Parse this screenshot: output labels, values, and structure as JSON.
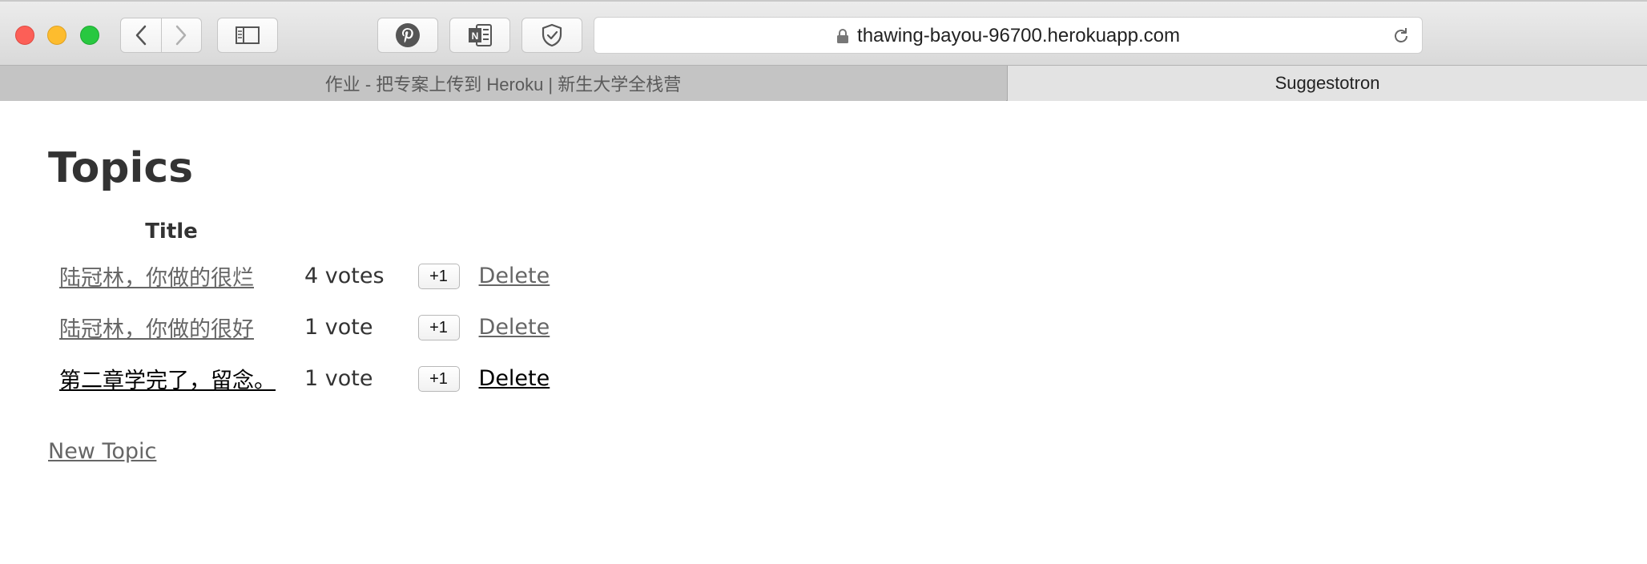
{
  "browser": {
    "url": "thawing-bayou-96700.herokuapp.com",
    "tabs": [
      {
        "label": "作业 - 把专案上传到 Heroku | 新生大学全栈营",
        "active": false
      },
      {
        "label": "Suggestotron",
        "active": true
      }
    ],
    "icons": [
      "back-icon",
      "forward-icon",
      "sidebar-icon",
      "pinterest-icon",
      "onenote-icon",
      "shield-icon",
      "lock-icon",
      "reload-icon"
    ]
  },
  "page": {
    "title": "Topics",
    "table": {
      "headers": [
        "Title"
      ],
      "rows": [
        {
          "title": "陆冠林，你做的很烂",
          "votes": "4 votes",
          "vote_button": "+1",
          "delete": "Delete"
        },
        {
          "title": "陆冠林，你做的很好",
          "votes": "1 vote",
          "vote_button": "+1",
          "delete": "Delete"
        },
        {
          "title": "第二章学完了，留念。",
          "votes": "1 vote",
          "vote_button": "+1",
          "delete": "Delete"
        }
      ]
    },
    "new_topic": "New Topic"
  },
  "colors": {
    "link_gray": "#666666",
    "link_dark": "#000000",
    "text": "#333333"
  }
}
